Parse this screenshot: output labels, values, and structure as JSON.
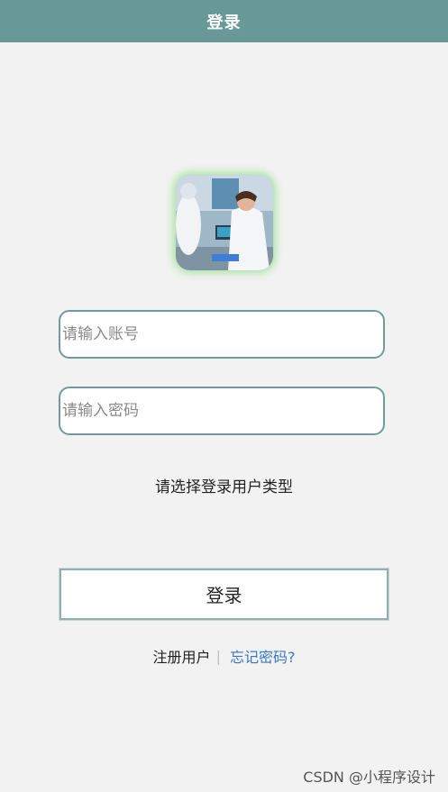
{
  "nav": {
    "title": "登录"
  },
  "form": {
    "account_placeholder": "请输入账号",
    "password_placeholder": "请输入密码",
    "user_type_prompt": "请选择登录用户类型",
    "login_label": "登录"
  },
  "links": {
    "register": "注册用户",
    "divider": "|",
    "forgot": "忘记密码?"
  },
  "watermark": "CSDN @小程序设计",
  "colors": {
    "header": "#699997",
    "field_border": "#6f9c9b",
    "link": "#3a78c6",
    "logo_glow": "#a9e3a1"
  }
}
